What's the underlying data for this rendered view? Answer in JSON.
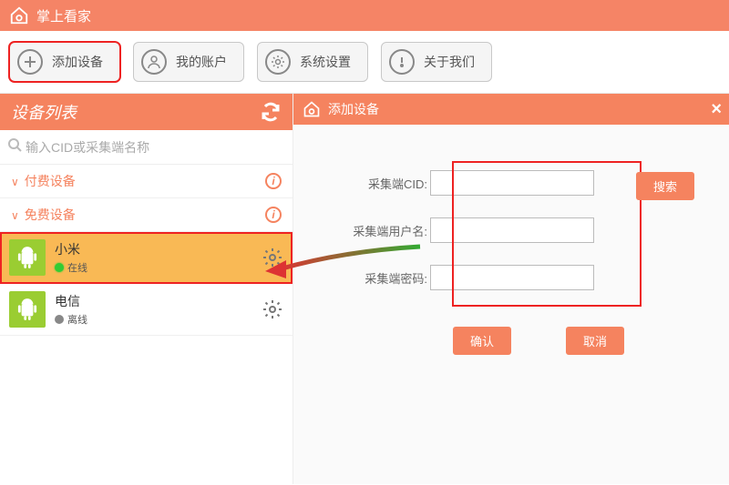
{
  "app": {
    "title": "掌上看家"
  },
  "toolbar": {
    "add_device": "添加设备",
    "my_account": "我的账户",
    "system_settings": "系统设置",
    "about_us": "关于我们"
  },
  "sidebar": {
    "title": "设备列表",
    "search_placeholder": "输入CID或采集端名称",
    "groups": [
      {
        "label": "付费设备"
      },
      {
        "label": "免费设备"
      }
    ],
    "devices": [
      {
        "name": "小米",
        "status": "在线",
        "online": true
      },
      {
        "name": "电信",
        "status": "离线",
        "online": false
      }
    ]
  },
  "panel": {
    "title": "添加设备",
    "labels": {
      "cid": "采集端CID:",
      "username": "采集端用户名:",
      "password": "采集端密码:"
    },
    "buttons": {
      "search": "搜索",
      "confirm": "确认",
      "cancel": "取消"
    }
  }
}
